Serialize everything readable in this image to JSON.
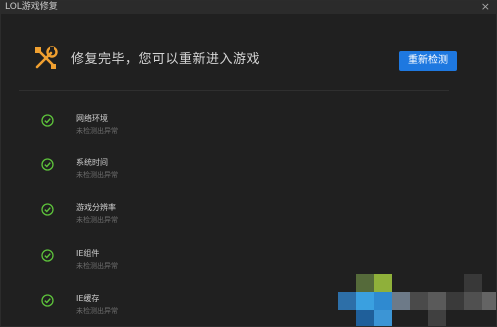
{
  "window": {
    "title": "LOL游戏修复",
    "close_label": "×"
  },
  "header": {
    "icon": "wrench-screwdriver-icon",
    "status": "修复完毕，您可以重新进入游戏",
    "recheck_label": "重新检测",
    "accent_color": "#f0a030",
    "button_color": "#1e78e0"
  },
  "items": [
    {
      "name": "网络环境",
      "status": "未检测出异常",
      "icon": "check-circle-icon"
    },
    {
      "name": "系统时间",
      "status": "未检测出异常",
      "icon": "check-circle-icon"
    },
    {
      "name": "游戏分辨率",
      "status": "未检测出异常",
      "icon": "check-circle-icon"
    },
    {
      "name": "IE组件",
      "status": "未检测出异常",
      "icon": "check-circle-icon"
    },
    {
      "name": "IE缓存",
      "status": "未检测出异常",
      "icon": "check-circle-icon"
    }
  ],
  "colors": {
    "check": "#5dc23b",
    "background": "#202020"
  }
}
